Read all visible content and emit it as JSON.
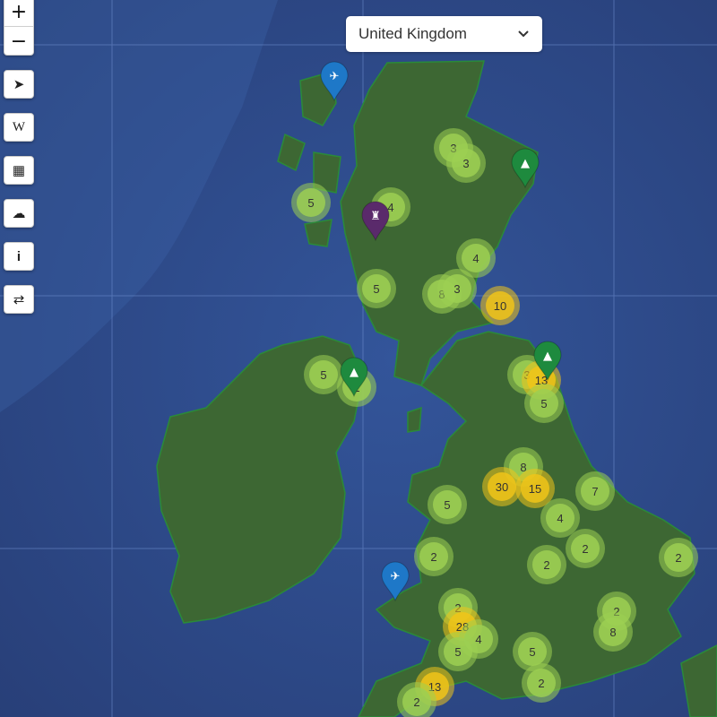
{
  "controls": {
    "zoom_in": "+",
    "zoom_out": "−",
    "tools": [
      {
        "name": "locate-icon",
        "glyph": "➤"
      },
      {
        "name": "wikipedia-icon",
        "glyph": "W"
      },
      {
        "name": "camera-icon",
        "glyph": "▦"
      },
      {
        "name": "cloud-icon",
        "glyph": "☁"
      },
      {
        "name": "info-icon",
        "glyph": "i"
      },
      {
        "name": "swap-icon",
        "glyph": "⇄"
      }
    ]
  },
  "region_select": {
    "value": "United Kingdom"
  },
  "colors": {
    "sea": "#2d4f8e",
    "land": "#3f6a34",
    "boundary": "#1f8a3a",
    "cluster_small": "#9ccf52",
    "cluster_large": "#f0c419",
    "pin_blue": "#1e78c8",
    "pin_green": "#1e8a3e",
    "pin_purple": "#5a2a6b"
  },
  "clusters": [
    {
      "count": "3"
    },
    {
      "count": "3"
    },
    {
      "count": "5"
    },
    {
      "count": "4"
    },
    {
      "count": "4"
    },
    {
      "count": "5"
    },
    {
      "count": "8"
    },
    {
      "count": "3"
    },
    {
      "count": "10"
    },
    {
      "count": "5"
    },
    {
      "count": "2"
    },
    {
      "count": "3"
    },
    {
      "count": "13"
    },
    {
      "count": "5"
    },
    {
      "count": "8"
    },
    {
      "count": "30"
    },
    {
      "count": "15"
    },
    {
      "count": "7"
    },
    {
      "count": "5"
    },
    {
      "count": "4"
    },
    {
      "count": "2"
    },
    {
      "count": "2"
    },
    {
      "count": "2"
    },
    {
      "count": "2"
    },
    {
      "count": "2"
    },
    {
      "count": "28"
    },
    {
      "count": "4"
    },
    {
      "count": "5"
    },
    {
      "count": "2"
    },
    {
      "count": "8"
    },
    {
      "count": "5"
    },
    {
      "count": "2"
    },
    {
      "count": "13"
    },
    {
      "count": "2"
    }
  ],
  "markers": [
    {
      "type": "airport",
      "icon": "airplane-icon"
    },
    {
      "type": "university",
      "icon": "graduation-cap-icon"
    },
    {
      "type": "castle",
      "icon": "castle-icon"
    },
    {
      "type": "university",
      "icon": "graduation-cap-icon"
    },
    {
      "type": "university",
      "icon": "graduation-cap-icon"
    },
    {
      "type": "airport",
      "icon": "airplane-icon"
    }
  ]
}
